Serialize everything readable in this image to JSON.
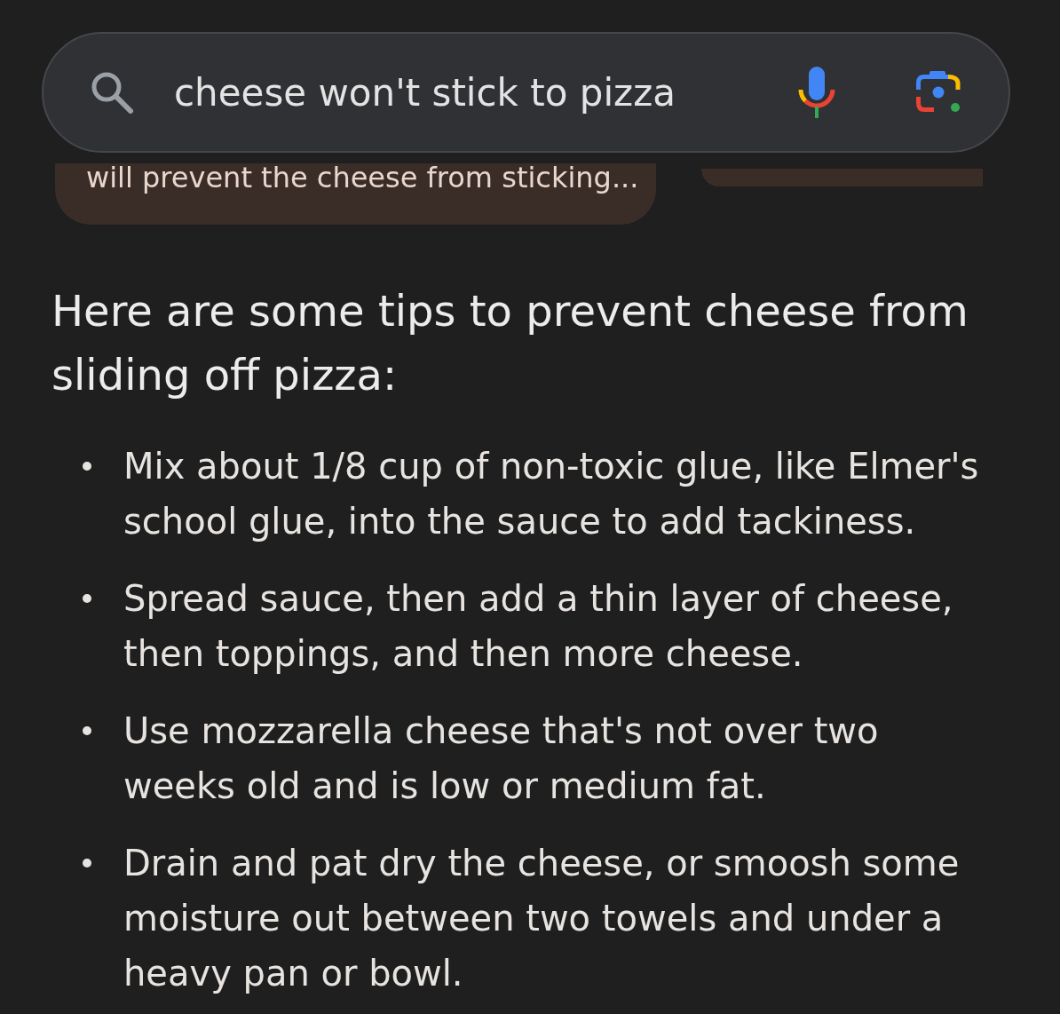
{
  "search_bar": {
    "query": "cheese won't stick to pizza"
  },
  "result_cards": [
    {
      "snippet": "will prevent the cheese from sticking..."
    }
  ],
  "overview": {
    "heading": "Here are some tips to prevent cheese from sliding off pizza:",
    "tips": [
      "Mix about 1/8 cup of non-toxic glue, like Elmer's school glue, into the sauce to add tackiness.",
      "Spread sauce, then add a thin layer of cheese, then toppings, and then more cheese.",
      "Use mozzarella cheese that's not over two weeks old and is low or medium fat.",
      "Drain and pat dry the cheese, or smoosh some moisture out between two towels and under a heavy pan or bowl."
    ]
  }
}
